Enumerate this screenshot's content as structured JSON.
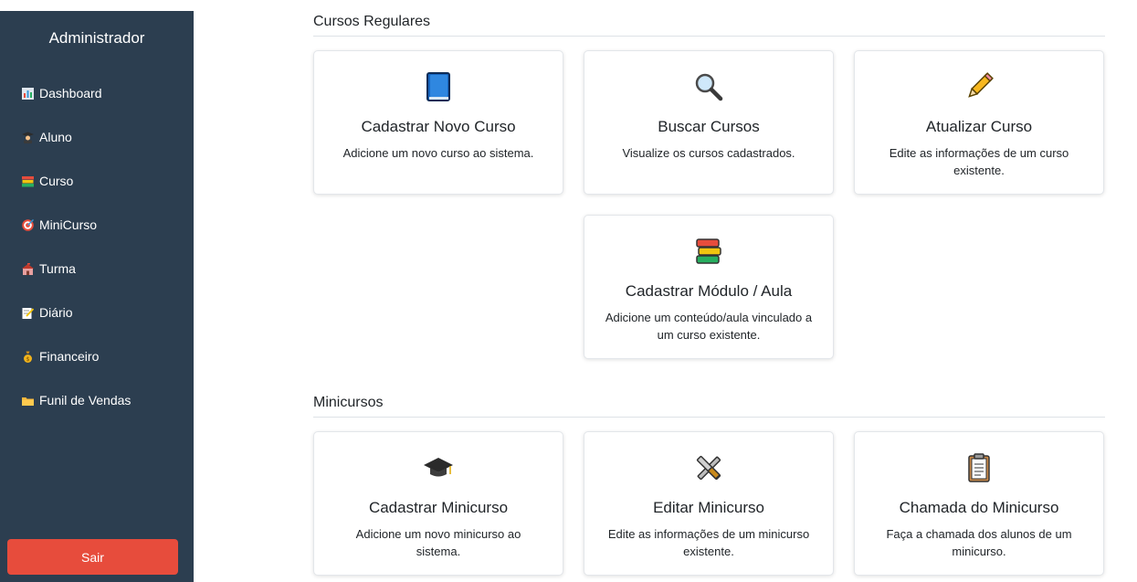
{
  "sidebar": {
    "title": "Administrador",
    "items": [
      {
        "label": "Dashboard",
        "icon": "bar-chart-icon"
      },
      {
        "label": "Aluno",
        "icon": "graduate-icon"
      },
      {
        "label": "Curso",
        "icon": "books-icon"
      },
      {
        "label": "MiniCurso",
        "icon": "target-icon"
      },
      {
        "label": "Turma",
        "icon": "school-icon"
      },
      {
        "label": "Diário",
        "icon": "memo-icon"
      },
      {
        "label": "Financeiro",
        "icon": "money-bag-icon"
      },
      {
        "label": "Funil de Vendas",
        "icon": "folder-icon"
      }
    ],
    "logout_label": "Sair",
    "colors": {
      "background": "#2c3e50",
      "logout": "#e74c3c"
    }
  },
  "sections": {
    "regular": {
      "title": "Cursos Regulares",
      "cards": [
        {
          "title": "Cadastrar Novo Curso",
          "desc": "Adicione um novo curso ao sistema.",
          "icon": "blue-book-icon"
        },
        {
          "title": "Buscar Cursos",
          "desc": "Visualize os cursos cadastrados.",
          "icon": "magnifier-icon"
        },
        {
          "title": "Atualizar Curso",
          "desc": "Edite as informações de um curso existente.",
          "icon": "pencil-icon"
        },
        {
          "title": "Cadastrar Módulo / Aula",
          "desc": "Adicione um conteúdo/aula vinculado a um curso existente.",
          "icon": "books-stack-icon"
        }
      ]
    },
    "mini": {
      "title": "Minicursos",
      "cards": [
        {
          "title": "Cadastrar Minicurso",
          "desc": "Adicione um novo minicurso ao sistema.",
          "icon": "graduation-cap-icon"
        },
        {
          "title": "Editar Minicurso",
          "desc": "Edite as informações de um minicurso existente.",
          "icon": "tools-icon"
        },
        {
          "title": "Chamada do Minicurso",
          "desc": "Faça a chamada dos alunos de um minicurso.",
          "icon": "clipboard-icon"
        }
      ]
    }
  }
}
